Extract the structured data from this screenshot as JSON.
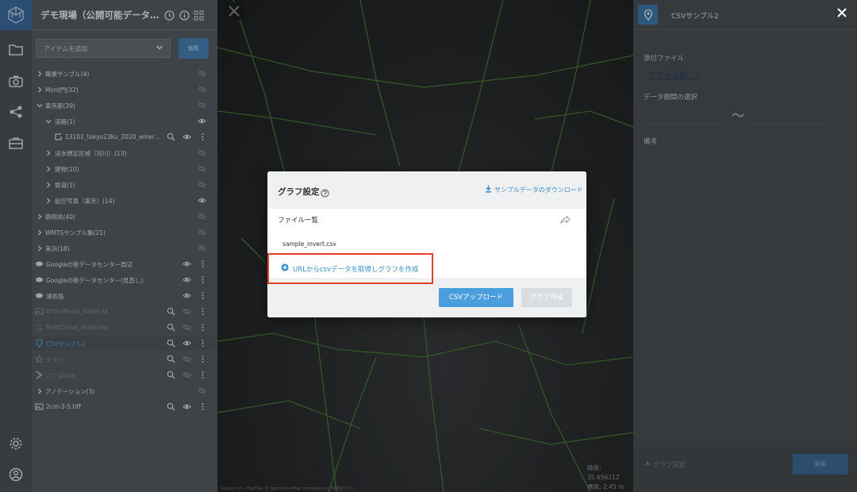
{
  "sidebar": {
    "project_title": "デモ現場（公開可能データの…",
    "add_item_placeholder": "アイテムを追加",
    "edit_label": "編集",
    "items": [
      {
        "label": "職業サンプル(4)"
      },
      {
        "label": "Mont門(32)"
      },
      {
        "label": "東京都(39)"
      },
      {
        "label": "道路(1)"
      },
      {
        "label": "13101_tokyo23ku_2020_emergency_..."
      },
      {
        "label": "浸水想定区域（河川）(13)"
      },
      {
        "label": "建物(10)"
      },
      {
        "label": "鉄道(1)"
      },
      {
        "label": "航空写真（東京）(14)"
      },
      {
        "label": "静岡県(40)"
      },
      {
        "label": "WMTSサンプル集(21)"
      },
      {
        "label": "美浜(18)"
      },
      {
        "label": "Googleの新データセンター周辺"
      },
      {
        "label": "Googleの新データセンター(見直し)"
      },
      {
        "label": "湖長島"
      },
      {
        "label": "OrthoPhoto_Ikoshi.tif"
      },
      {
        "label": "PointCloud_Ikoshi.las"
      },
      {
        "label": "CSVサンプル2"
      },
      {
        "label": "テスト"
      },
      {
        "label": "ここはのw"
      },
      {
        "label": "アノテーション(3)"
      },
      {
        "label": "2cm-3-5.tiff"
      }
    ]
  },
  "map": {
    "coords_lat": "緯度: 35.656212",
    "coords_alt": "標高: 2.45 m",
    "attribution": "Cesium ion | MapTiler © OpenStreetMap contributors | 地理院タイル"
  },
  "right_panel": {
    "title": "CSVサンプル2",
    "attached_label": "添付ファイル",
    "file_count_link": "ファイル数：1",
    "period_label": "データ期間の選択",
    "tilde": "〜",
    "notes_label": "備考",
    "graph_settings": "グラフ設定",
    "edit_label": "編集"
  },
  "dialog": {
    "title": "グラフ設定",
    "download_link": "サンプルデータのダウンロード",
    "file_list_label": "ファイル一覧",
    "file_name": "sample_invert.csv",
    "url_link": "URLからcsvデータを取得しグラフを作成",
    "upload_button": "CSVアップロード",
    "create_button": "グラフ作成"
  },
  "colors": {
    "accent_blue": "#4a9edb",
    "highlight_red": "#e0412b",
    "sidebar_bg": "#5a6166",
    "road_green": "#4e8a3a"
  }
}
